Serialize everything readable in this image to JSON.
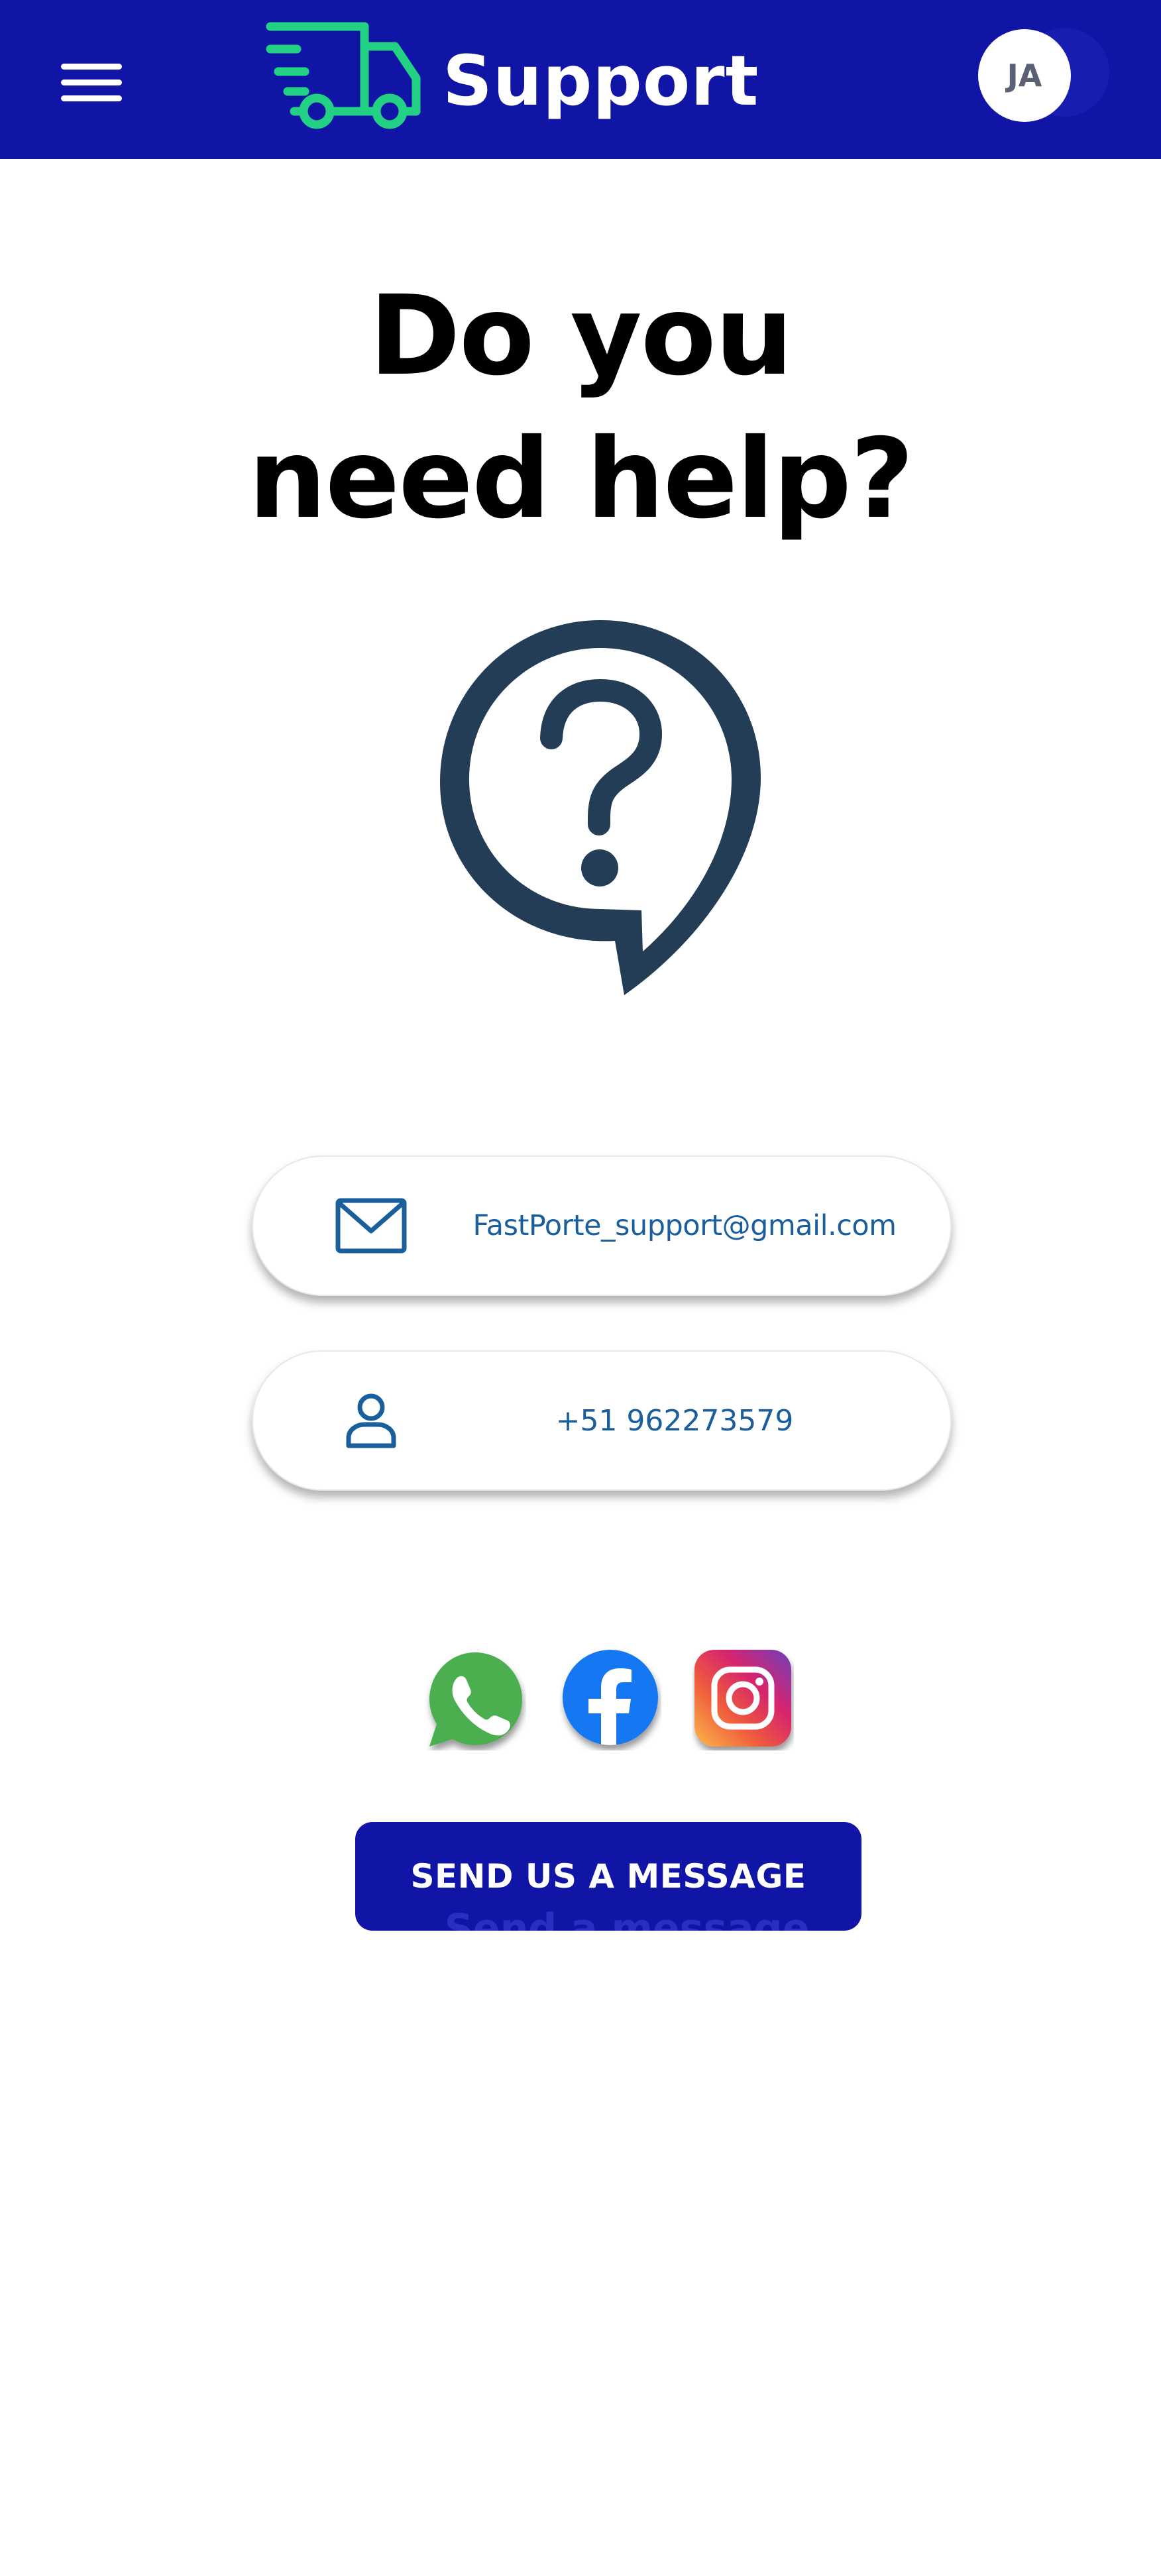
{
  "header": {
    "title": "Support",
    "avatar_initials": "JA",
    "background_color": "#1015a6",
    "logo_icon": "delivery-truck-icon",
    "logo_color": "#22d184",
    "menu_icon": "hamburger-menu-icon"
  },
  "main": {
    "headline_line1": "Do you",
    "headline_line2": "need help?",
    "help_icon": "question-chat-bubble-icon",
    "help_icon_color": "#233d57"
  },
  "contacts": {
    "email": {
      "icon": "mail-icon",
      "value": "FastPorte_support@gmail.com"
    },
    "phone": {
      "icon": "person-icon",
      "value": "+51 962273579"
    },
    "text_color": "#1a5e9c"
  },
  "social": [
    {
      "name": "whatsapp",
      "icon": "whatsapp-icon",
      "color": "#4cae4f"
    },
    {
      "name": "facebook",
      "icon": "facebook-icon",
      "color": "#1977f3"
    },
    {
      "name": "instagram",
      "icon": "instagram-icon",
      "color": "#c13584"
    }
  ],
  "cta": {
    "label": "SEND US A MESSAGE",
    "ghost_label": "Send a message"
  }
}
